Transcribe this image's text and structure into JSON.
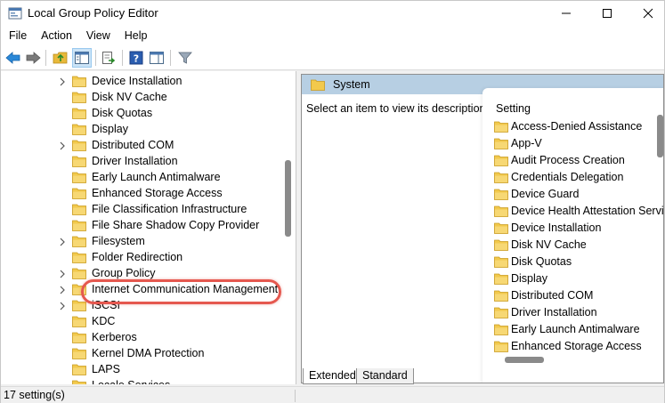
{
  "window": {
    "title": "Local Group Policy Editor"
  },
  "menu": [
    "File",
    "Action",
    "View",
    "Help"
  ],
  "tree": {
    "items": [
      {
        "label": "Device Installation",
        "expandable": true
      },
      {
        "label": "Disk NV Cache",
        "expandable": false
      },
      {
        "label": "Disk Quotas",
        "expandable": false
      },
      {
        "label": "Display",
        "expandable": false
      },
      {
        "label": "Distributed COM",
        "expandable": true
      },
      {
        "label": "Driver Installation",
        "expandable": false
      },
      {
        "label": "Early Launch Antimalware",
        "expandable": false
      },
      {
        "label": "Enhanced Storage Access",
        "expandable": false
      },
      {
        "label": "File Classification Infrastructure",
        "expandable": false
      },
      {
        "label": "File Share Shadow Copy Provider",
        "expandable": false
      },
      {
        "label": "Filesystem",
        "expandable": true
      },
      {
        "label": "Folder Redirection",
        "expandable": false
      },
      {
        "label": "Group Policy",
        "expandable": true
      },
      {
        "label": "Internet Communication Management",
        "expandable": true
      },
      {
        "label": "iSCSI",
        "expandable": true
      },
      {
        "label": "KDC",
        "expandable": false
      },
      {
        "label": "Kerberos",
        "expandable": false
      },
      {
        "label": "Kernel DMA Protection",
        "expandable": false
      },
      {
        "label": "LAPS",
        "expandable": false
      },
      {
        "label": "Locale Services",
        "expandable": false
      }
    ]
  },
  "right_pane": {
    "header": "System",
    "description": "Select an item to view its description.",
    "column_header": "Setting",
    "settings": [
      "Access-Denied Assistance",
      "App-V",
      "Audit Process Creation",
      "Credentials Delegation",
      "Device Guard",
      "Device Health Attestation Service",
      "Device Installation",
      "Disk NV Cache",
      "Disk Quotas",
      "Display",
      "Distributed COM",
      "Driver Installation",
      "Early Launch Antimalware",
      "Enhanced Storage Access"
    ]
  },
  "tabs": [
    "Extended",
    "Standard"
  ],
  "status": {
    "text": "17 setting(s)"
  },
  "colors": {
    "folder": "#f2c94c",
    "folder_dark": "#d9a520",
    "header_bg": "#b7cfe3",
    "highlight": "#e5584f",
    "accent": "#0078d4"
  }
}
